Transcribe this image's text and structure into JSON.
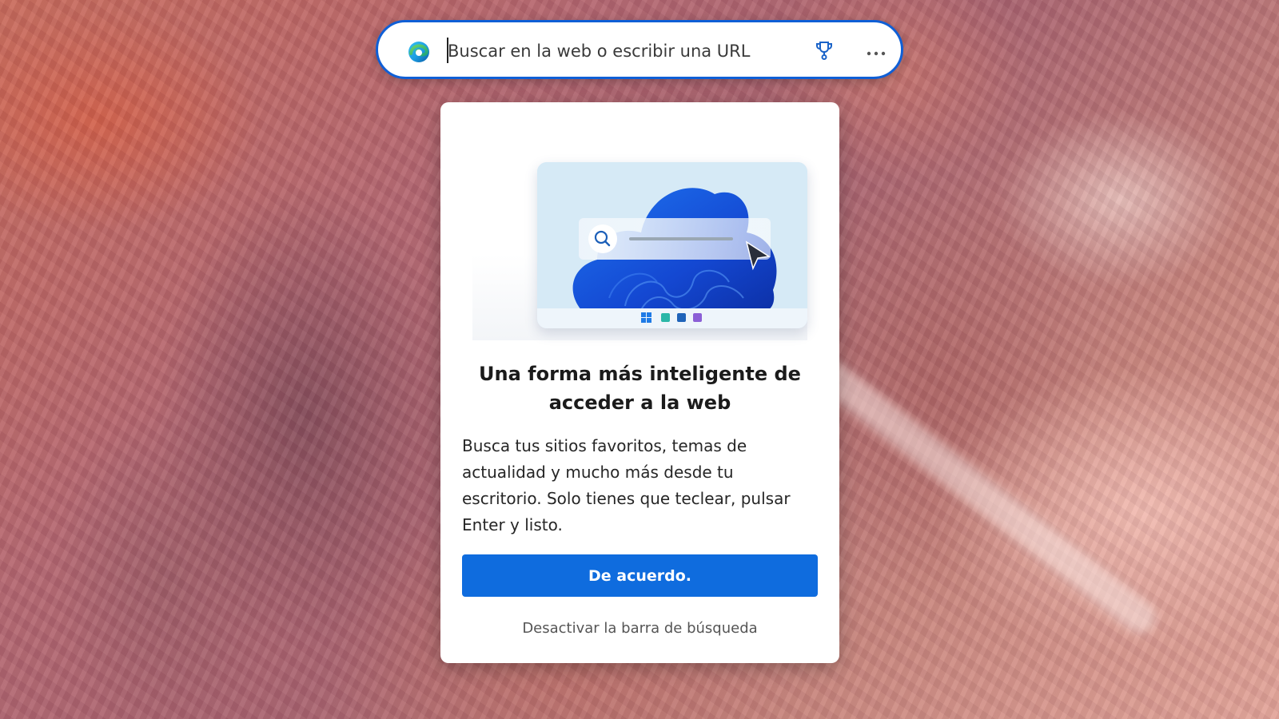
{
  "search": {
    "placeholder": "Buscar en la web o escribir una URL",
    "value": ""
  },
  "icons": {
    "browser_logo": "edge-logo-icon",
    "rewards": "trophy-icon",
    "more": "more-options-icon"
  },
  "popup": {
    "title": "Una forma más inteligente de acceder a la web",
    "body": "Busca tus sitios favoritos, temas de actualidad y mucho más desde tu escritorio. Solo tienes que teclear, pulsar Enter y listo.",
    "primary_button": "De acuerdo.",
    "secondary_link": "Desactivar la barra de búsqueda"
  },
  "colors": {
    "accent": "#0f6cde",
    "searchbar_border": "#0f5fd6"
  }
}
